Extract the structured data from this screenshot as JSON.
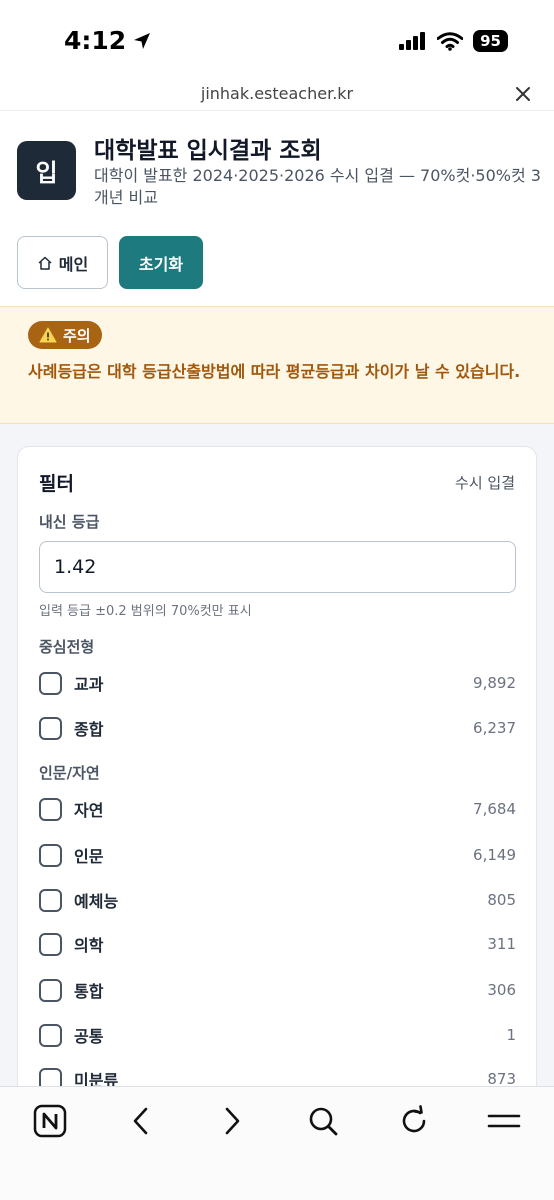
{
  "status": {
    "time": "4:12",
    "battery": "95"
  },
  "url": {
    "domain": "jinhak.esteacher.kr"
  },
  "header": {
    "logo_text": "입",
    "title": "대학발표 입시결과 조회",
    "subtitle": "대학이 발표한 2024·2025·2026 수시 입결 — 70%컷·50%컷 3개년 비교",
    "main_label": "메인",
    "reset_label": "초기화"
  },
  "warning": {
    "badge": "주의",
    "text": "사례등급은 대학 등급산출방법에 따라 평균등급과 차이가 날 수 있습니다."
  },
  "filter": {
    "title": "필터",
    "mode": "수시 입결",
    "grade_label": "내신 등급",
    "grade_value": "1.42",
    "grade_hint": "입력 등급 ±0.2 범위의 70%컷만 표시",
    "admission_label": "중심전형",
    "admission": [
      {
        "label": "교과",
        "count": "9,892"
      },
      {
        "label": "종합",
        "count": "6,237"
      }
    ],
    "field_label": "인문/자연",
    "fields": [
      {
        "label": "자연",
        "count": "7,684"
      },
      {
        "label": "인문",
        "count": "6,149"
      },
      {
        "label": "예체능",
        "count": "805"
      },
      {
        "label": "의학",
        "count": "311"
      },
      {
        "label": "통합",
        "count": "306"
      },
      {
        "label": "공통",
        "count": "1"
      },
      {
        "label": "미분류",
        "count": "873"
      }
    ]
  },
  "icons": [
    "location-arrow-icon",
    "signal-icon",
    "wifi-icon",
    "battery-icon",
    "close-icon",
    "warning-icon",
    "home-icon",
    "browser-logo-icon",
    "back-icon",
    "forward-icon",
    "search-icon",
    "reload-icon",
    "menu-icon"
  ],
  "colors": {
    "accent": "#1d7a7f",
    "logo_bg": "#1f2a38",
    "warning_bg": "#fff7e6",
    "warning_text": "#a0580d",
    "warning_badge": "#a86412"
  }
}
